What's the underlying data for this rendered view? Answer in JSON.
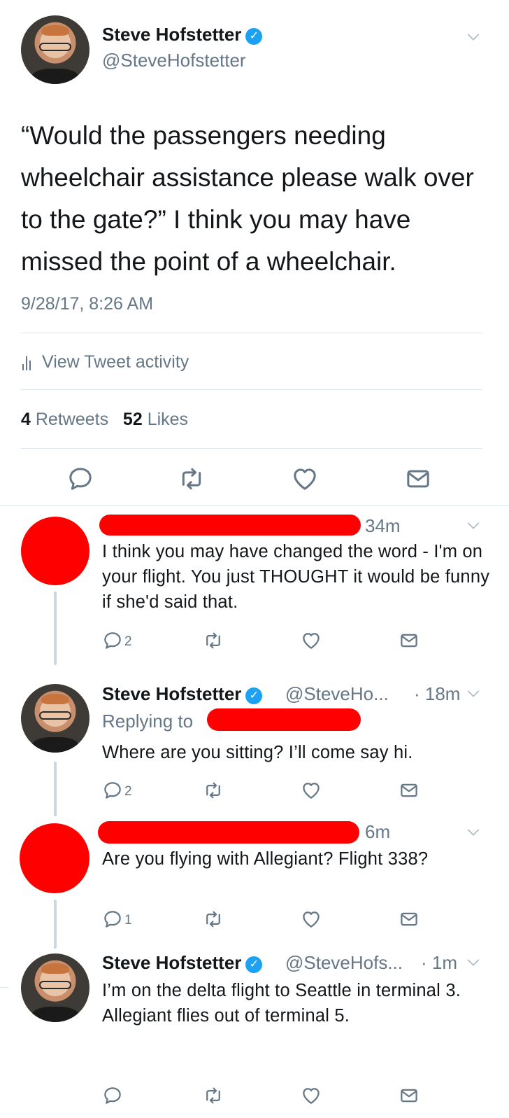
{
  "tweet": {
    "author_name": "Steve Hofstetter",
    "author_handle": "@SteveHofstetter",
    "text": "“Would the passengers needing wheelchair assistance please walk over to the gate?” I think you may have missed the point of a wheelchair.",
    "timestamp": "9/28/17, 8:26 AM",
    "activity_label": "View Tweet activity",
    "retweets_count": "4",
    "retweets_label": "Retweets",
    "likes_count": "52",
    "likes_label": "Likes"
  },
  "replies": [
    {
      "time": "34m",
      "text": "I think you may have changed the word - I'm on your flight. You just THOUGHT it would be funny if she'd said that.",
      "reply_count": "2"
    },
    {
      "author_name": "Steve Hofstetter",
      "author_handle": "@SteveHo...",
      "time": "· 18m",
      "replying_to": "Replying to",
      "text": "Where are you sitting? I’ll come say hi.",
      "reply_count": "2"
    },
    {
      "time": "6m",
      "text": "Are you flying with Allegiant? Flight 338?",
      "reply_count": "1"
    },
    {
      "author_name": "Steve Hofstetter",
      "author_handle": "@SteveHofs...",
      "time": "· 1m",
      "text": "I’m on the delta flight to Seattle in terminal 3. Allegiant flies out of terminal 5."
    }
  ],
  "icons": {
    "reply": "reply-icon",
    "retweet": "retweet-icon",
    "like": "heart-icon",
    "message": "envelope-icon",
    "verified": "verified-badge-icon",
    "more": "chevron-down-icon"
  },
  "colors": {
    "verified_blue": "#1da1f2",
    "gray_text": "#657786",
    "divider": "#e1e8ed",
    "redaction": "#ff0000"
  }
}
